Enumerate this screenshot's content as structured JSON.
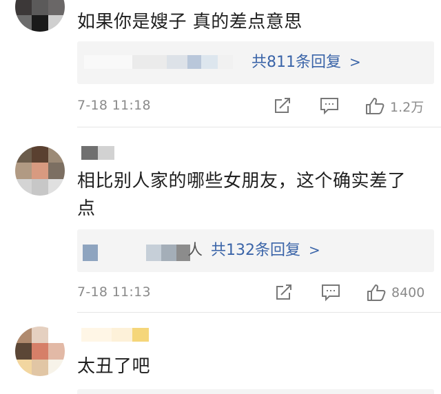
{
  "comments": [
    {
      "text": "如果你是嫂子 真的差点意思",
      "reply_link": "共811条回复",
      "time": "7-18 11:18",
      "likes": "1.2万"
    },
    {
      "text": "相比别人家的哪些女朋友，这个确实差了点",
      "reply_prefix": "人",
      "reply_link": "共132条回复",
      "time": "7-18 11:13",
      "likes": "8400"
    },
    {
      "text": "太丑了吧"
    }
  ],
  "icons": {
    "share": "share-icon",
    "comment": "comment-icon",
    "like": "like-icon",
    "chevron": "chevron-right-icon"
  },
  "colors": {
    "link": "#3a64a8",
    "meta": "#8a8a8a",
    "text": "#1f1f1f",
    "reply_bg": "#f4f4f4"
  }
}
